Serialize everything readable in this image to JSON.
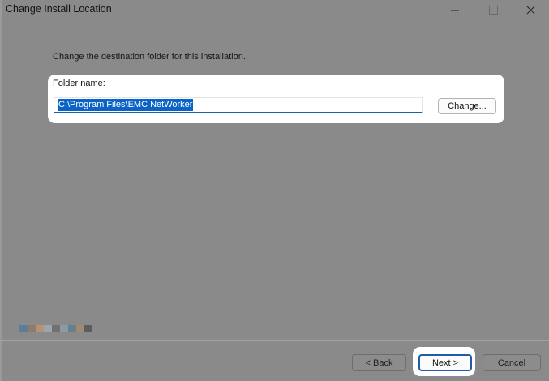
{
  "window": {
    "title": "Change Install Location"
  },
  "dialog": {
    "instruction": "Change the destination folder for this installation.",
    "folder_label": "Folder name:",
    "folder_value": "C:\\Program Files\\EMC NetWorker",
    "change_button": "Change..."
  },
  "footer": {
    "back_button": "< Back",
    "next_button": "Next >",
    "cancel_button": "Cancel"
  },
  "logo_colors": [
    "#5a7e95",
    "#8e7b6a",
    "#b89277",
    "#9aa6ad",
    "#707070",
    "#899ca5",
    "#68808d",
    "#a08a73",
    "#5d5d5d",
    "#707070"
  ],
  "colors": {
    "accent": "#1e5ea8",
    "selection": "#0a64c8",
    "overlay": "#8a8a8a"
  }
}
